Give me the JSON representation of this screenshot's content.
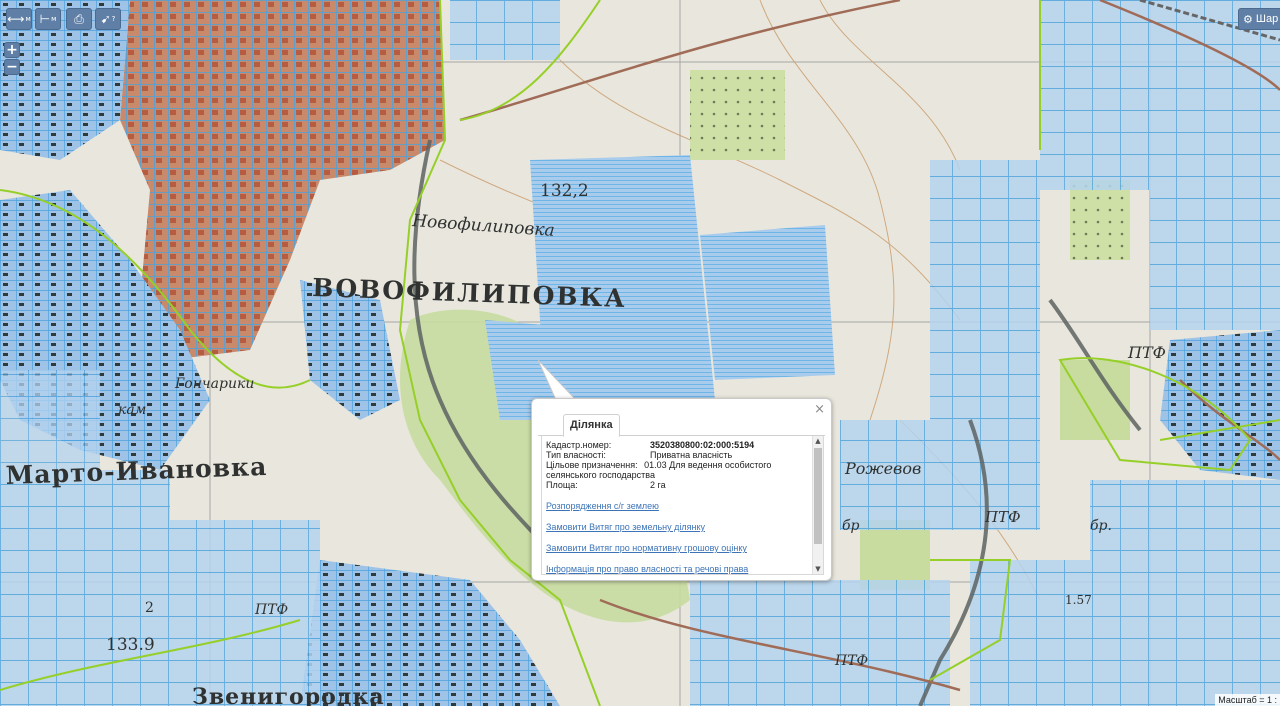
{
  "toolbar": {
    "measure_length_label": "м",
    "measure_area_label": "м",
    "print_icon": "print-icon",
    "identify_label": "?"
  },
  "zoom": {
    "in_label": "+",
    "out_label": "−"
  },
  "share": {
    "label": "Шар"
  },
  "map_labels": [
    "ВОВОФИЛИПОВКА",
    "Новофилиповка",
    "Марто-Ивановка",
    "Звенигородка",
    "Рожевов",
    "ПТФ",
    "ПТФ",
    "ПТФ",
    "ПТФ",
    "Гончарики",
    "132,2",
    "133.9",
    "кам",
    "2",
    "бр",
    "бр.",
    "1.57"
  ],
  "popup": {
    "tab_label": "Ділянка",
    "close_label": "×",
    "fields": [
      {
        "label": "Кадастр.номер:",
        "value": "3520380800:02:000:5194"
      },
      {
        "label": "Тип власності:",
        "value": "Приватна власність"
      },
      {
        "label": "Цільове призначення:",
        "value": "01.03 Для ведення особистого селянського господарства"
      },
      {
        "label": "Площа:",
        "value": "2 га"
      }
    ],
    "links": [
      "Розпорядження с/г землею",
      "Замовити Витяг про земельну ділянку",
      "Замовити Витяг про нормативну грошову оцінку",
      "Інформація про право власності та речові права"
    ]
  },
  "scale": {
    "label": "Масштаб = 1 :"
  },
  "colors": {
    "parcel_fill": "#a9cbec",
    "parcel_stroke": "#4ba2de",
    "boundary": "#96cf28",
    "urban": "#b46e55",
    "forest": "#c8dca0",
    "road": "#6a6f6d",
    "river": "#a06c58"
  }
}
